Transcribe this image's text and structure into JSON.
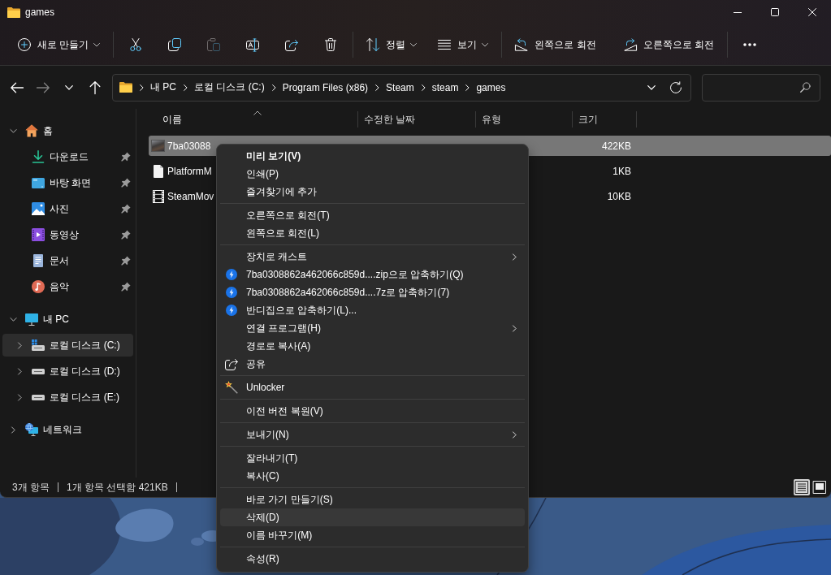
{
  "window": {
    "title": "games"
  },
  "toolbar": {
    "groups": [
      {
        "items": [
          {
            "kind": "new",
            "label": "새로 만들기",
            "has_menu": true,
            "disabled": false
          }
        ]
      },
      {
        "items": [
          {
            "kind": "cut",
            "has_menu": false,
            "disabled": false
          },
          {
            "kind": "copy",
            "has_menu": false,
            "disabled": false
          },
          {
            "kind": "paste",
            "has_menu": false,
            "disabled": true
          },
          {
            "kind": "rename",
            "has_menu": false,
            "disabled": false
          },
          {
            "kind": "share",
            "has_menu": false,
            "disabled": false
          },
          {
            "kind": "delete",
            "has_menu": false,
            "disabled": false
          }
        ]
      },
      {
        "items": [
          {
            "kind": "sort",
            "label": "정렬",
            "has_menu": true,
            "disabled": false
          },
          {
            "kind": "view",
            "label": "보기",
            "has_menu": true,
            "disabled": false
          }
        ]
      },
      {
        "items": [
          {
            "kind": "rotate-left",
            "label": "왼쪽으로 회전",
            "has_menu": false,
            "disabled": false
          },
          {
            "kind": "rotate-right",
            "label": "오른쪽으로 회전",
            "has_menu": false,
            "disabled": false
          }
        ]
      },
      {
        "items": [
          {
            "kind": "more",
            "has_menu": false,
            "disabled": false
          }
        ]
      }
    ]
  },
  "nav": [
    {
      "kind": "back",
      "disabled": false
    },
    {
      "kind": "forward",
      "disabled": true
    },
    {
      "kind": "recent",
      "disabled": false
    },
    {
      "kind": "up",
      "disabled": false
    }
  ],
  "address": {
    "segments": [
      "내 PC",
      "로컬 디스크 (C:)",
      "Program Files (x86)",
      "Steam",
      "steam",
      "games"
    ]
  },
  "sidebar": {
    "items": [
      {
        "kind": "home",
        "label": "홈",
        "expanded": true,
        "selected": false,
        "children": [
          {
            "kind": "download",
            "label": "다운로드",
            "pinned": true,
            "selected": false
          },
          {
            "kind": "desktop",
            "label": "바탕 화면",
            "pinned": true,
            "selected": false
          },
          {
            "kind": "pictures",
            "label": "사진",
            "pinned": true,
            "selected": false
          },
          {
            "kind": "videos",
            "label": "동영상",
            "pinned": true,
            "selected": false
          },
          {
            "kind": "documents",
            "label": "문서",
            "pinned": true,
            "selected": false
          },
          {
            "kind": "music",
            "label": "음악",
            "pinned": true,
            "selected": false
          }
        ]
      },
      {
        "kind": "pc",
        "label": "내 PC",
        "expanded": true,
        "selected": false,
        "children": [
          {
            "kind": "system-drive",
            "label": "로컬 디스크 (C:)",
            "expanded": false,
            "selected": true
          },
          {
            "kind": "drive",
            "label": "로컬 디스크 (D:)",
            "expanded": false,
            "selected": false
          },
          {
            "kind": "drive",
            "label": "로컬 디스크 (E:)",
            "expanded": false,
            "selected": false
          }
        ]
      },
      {
        "kind": "network",
        "label": "네트워크",
        "expanded": false,
        "selected": false
      }
    ]
  },
  "file_list": {
    "columns": [
      {
        "label": "이름",
        "sorted": true
      },
      {
        "label": "수정한 날짜",
        "sorted": false
      },
      {
        "label": "유형",
        "sorted": false
      },
      {
        "label": "크기",
        "sorted": false
      }
    ],
    "rows": [
      {
        "kind": "image",
        "name": "7ba03088",
        "size": "422KB",
        "selected": true
      },
      {
        "kind": "file",
        "name": "PlatformM",
        "size": "1KB",
        "selected": false
      },
      {
        "kind": "video",
        "name": "SteamMov",
        "size": "10KB",
        "selected": false
      }
    ]
  },
  "context_menu": {
    "groups": [
      {
        "items": [
          {
            "kind": "plain",
            "label": "미리 보기(V)",
            "default": true,
            "has_submenu": false,
            "hovered": false
          },
          {
            "kind": "plain",
            "label": "인쇄(P)",
            "default": false,
            "has_submenu": false,
            "hovered": false
          },
          {
            "kind": "plain",
            "label": "즐겨찾기에 추가",
            "default": false,
            "has_submenu": false,
            "hovered": false
          }
        ]
      },
      {
        "items": [
          {
            "kind": "plain",
            "label": "오른쪽으로 회전(T)",
            "default": false,
            "has_submenu": false,
            "hovered": false
          },
          {
            "kind": "plain",
            "label": "왼쪽으로 회전(L)",
            "default": false,
            "has_submenu": false,
            "hovered": false
          }
        ]
      },
      {
        "items": [
          {
            "kind": "plain",
            "label": "장치로 캐스트",
            "default": false,
            "has_submenu": true,
            "hovered": false
          },
          {
            "kind": "compress",
            "label": "7ba0308862a462066c859d....zip으로 압축하기(Q)",
            "default": false,
            "has_submenu": false,
            "hovered": false
          },
          {
            "kind": "compress",
            "label": "7ba0308862a462066c859d....7z로 압축하기(7)",
            "default": false,
            "has_submenu": false,
            "hovered": false
          },
          {
            "kind": "compress",
            "label": "반디집으로 압축하기(L)...",
            "default": false,
            "has_submenu": false,
            "hovered": false
          },
          {
            "kind": "plain",
            "label": "연결 프로그램(H)",
            "default": false,
            "has_submenu": true,
            "hovered": false
          },
          {
            "kind": "plain",
            "label": "경로로 복사(A)",
            "default": false,
            "has_submenu": false,
            "hovered": false
          },
          {
            "kind": "share",
            "label": "공유",
            "default": false,
            "has_submenu": false,
            "hovered": false
          }
        ]
      },
      {
        "items": [
          {
            "kind": "wand",
            "label": "Unlocker",
            "default": false,
            "has_submenu": false,
            "hovered": false
          }
        ]
      },
      {
        "items": [
          {
            "kind": "plain",
            "label": "이전 버전 복원(V)",
            "default": false,
            "has_submenu": false,
            "hovered": false
          }
        ]
      },
      {
        "items": [
          {
            "kind": "plain",
            "label": "보내기(N)",
            "default": false,
            "has_submenu": true,
            "hovered": false
          }
        ]
      },
      {
        "items": [
          {
            "kind": "plain",
            "label": "잘라내기(T)",
            "default": false,
            "has_submenu": false,
            "hovered": false
          },
          {
            "kind": "plain",
            "label": "복사(C)",
            "default": false,
            "has_submenu": false,
            "hovered": false
          }
        ]
      },
      {
        "items": [
          {
            "kind": "plain",
            "label": "바로 가기 만들기(S)",
            "default": false,
            "has_submenu": false,
            "hovered": false
          },
          {
            "kind": "plain",
            "label": "삭제(D)",
            "default": false,
            "has_submenu": false,
            "hovered": true
          },
          {
            "kind": "plain",
            "label": "이름 바꾸기(M)",
            "default": false,
            "has_submenu": false,
            "hovered": false
          }
        ]
      },
      {
        "items": [
          {
            "kind": "plain",
            "label": "속성(R)",
            "default": false,
            "has_submenu": false,
            "hovered": false
          }
        ]
      }
    ]
  },
  "status_bar": {
    "texts": [
      "3개 항목",
      "1개 항목 선택함 421KB"
    ],
    "view_buttons": [
      {
        "kind": "details",
        "selected": true
      },
      {
        "kind": "tiles",
        "selected": false
      }
    ]
  }
}
